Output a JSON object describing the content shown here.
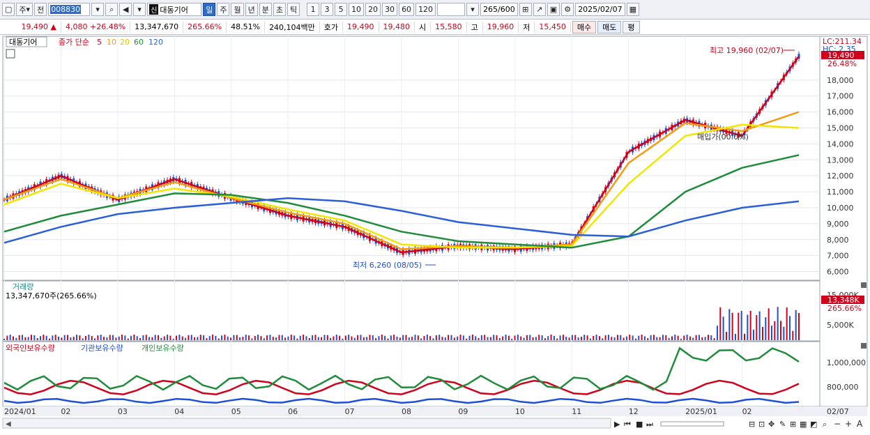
{
  "toolbar": {
    "type_label": "주",
    "prev_label": "전",
    "stock_code": "008830",
    "stock_badge": "신",
    "stock_name": "대동기어",
    "period_buttons": [
      "일",
      "주",
      "월",
      "년",
      "분",
      "초",
      "틱"
    ],
    "selected_period": "일",
    "interval_buttons": [
      "1",
      "3",
      "5",
      "10",
      "20",
      "30",
      "60",
      "120"
    ],
    "count_value": "265",
    "count_total": "600",
    "date_value": "2025/02/07"
  },
  "quote": {
    "price": "19,490",
    "change": "4,080",
    "change_pct": "+26.48%",
    "volume": "13,347,670",
    "volume_ratio": "265.66%",
    "turnover": "48.51%",
    "amount": "240,104백만",
    "ask_label": "호가",
    "ask": "19,490",
    "bid": "19,480",
    "open_label": "시",
    "open": "15,580",
    "high_label": "고",
    "high": "19,960",
    "low_label": "저",
    "low": "15,450",
    "buy_label": "매수",
    "sell_label": "매도",
    "eval_label": "평"
  },
  "price_panel": {
    "stock_label": "대동기어",
    "ma_title": "종가 단순",
    "ma_periods": [
      "5",
      "10",
      "20",
      "60",
      "120"
    ],
    "ma_colors": [
      "#d0021b",
      "#f39c12",
      "#f2e600",
      "#1e8c3a",
      "#2b5fd9"
    ],
    "lc_label": "LC:211.34",
    "hc_label": "HC: 2.35",
    "y_ticks": [
      "6,000",
      "7,000",
      "8,000",
      "9,000",
      "10,000",
      "11,000",
      "12,000",
      "13,000",
      "14,000",
      "15,000",
      "16,000",
      "17,000",
      "18,000"
    ],
    "current_price_tag": "19,490",
    "current_pct_tag": "26.48%",
    "high_annotation": "최고 19,960 (02/07)",
    "low_annotation": "최저 6,260 (08/05)",
    "crosshair_label": "매입가(00.0%)"
  },
  "volume_panel": {
    "title": "거래량",
    "value": "13,347,670주(265.66%)",
    "y_ticks": [
      "5,000K",
      "15,000K"
    ],
    "current_tag": "13,348K",
    "current_pct_tag": "265.66%"
  },
  "holding_panel": {
    "series_labels": [
      "외국인보유수량",
      "기관보유수량",
      "개인보유수량"
    ],
    "y_ticks": [
      "800,000",
      "1,000,000"
    ]
  },
  "x_axis": {
    "labels": [
      "2024/01",
      "02",
      "03",
      "04",
      "05",
      "06",
      "07",
      "08",
      "09",
      "10",
      "11",
      "12",
      "2025/01",
      "02"
    ],
    "right_label": "02/07"
  },
  "colors": {
    "up": "#d0021b",
    "down": "#1d4fd8",
    "accent": "#2e6cc9"
  },
  "chart_data": {
    "type": "line",
    "x": [
      "2024/01",
      "02",
      "03",
      "04",
      "05",
      "06",
      "07",
      "08",
      "09",
      "10",
      "11",
      "12",
      "2025/01",
      "02",
      "02/07"
    ],
    "series": [
      {
        "name": "5",
        "values": [
          10500,
          12000,
          10500,
          11800,
          10600,
          9500,
          8800,
          7200,
          7600,
          7400,
          7700,
          13500,
          15500,
          14500,
          19490
        ]
      },
      {
        "name": "10",
        "values": [
          10500,
          11800,
          10600,
          11600,
          10600,
          9700,
          9000,
          7400,
          7600,
          7500,
          7700,
          12800,
          15300,
          14800,
          16000
        ]
      },
      {
        "name": "20",
        "values": [
          10200,
          11500,
          10600,
          11200,
          10700,
          9900,
          9200,
          7700,
          7500,
          7500,
          7600,
          11500,
          14500,
          15200,
          15000
        ]
      },
      {
        "name": "60",
        "values": [
          8500,
          9500,
          10200,
          10900,
          10800,
          10300,
          9500,
          8500,
          7900,
          7700,
          7500,
          8200,
          11000,
          12500,
          13300
        ]
      },
      {
        "name": "120",
        "values": [
          7800,
          8800,
          9600,
          10000,
          10300,
          10600,
          10400,
          9800,
          9100,
          8700,
          8300,
          8200,
          9200,
          10000,
          10400
        ]
      }
    ],
    "ylim": [
      5500,
      20000
    ]
  }
}
